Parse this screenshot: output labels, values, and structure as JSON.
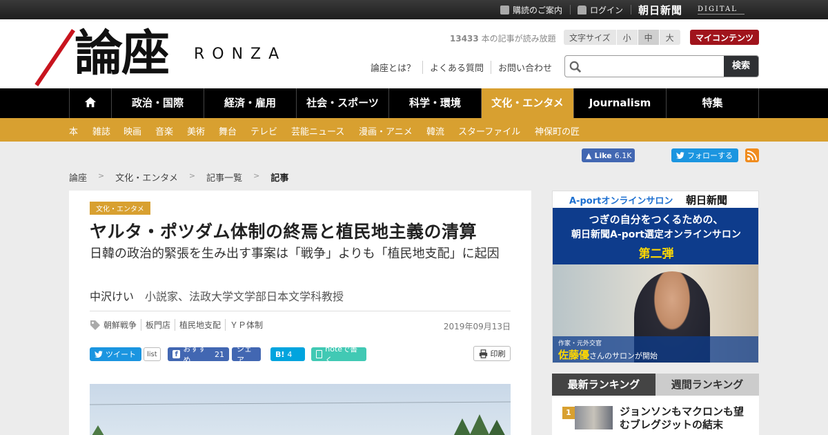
{
  "topbar": {
    "subscribe": "購読のご案内",
    "login": "ログイン",
    "brand": "朝日新聞",
    "brand_suffix": "DIGITAL"
  },
  "header": {
    "logo_kanji": "論座",
    "logo_roman": "RONZA",
    "reading_count": "13433",
    "reading_suffix": "本の記事が読み放題",
    "fontsize_label": "文字サイズ",
    "fontsize_options": [
      "小",
      "中",
      "大"
    ],
    "fontsize_selected": "中",
    "my_contents": "マイコンテンツ",
    "links": [
      "論座とは？",
      "よくある質問",
      "お問い合わせ"
    ],
    "search_placeholder": "",
    "search_button": "検索"
  },
  "nav": {
    "items": [
      "政治・国際",
      "経済・雇用",
      "社会・スポーツ",
      "科学・環境",
      "文化・エンタメ",
      "Journalism",
      "特集"
    ],
    "active": "文化・エンタメ"
  },
  "subnav": {
    "items": [
      "本",
      "雑誌",
      "映画",
      "音楽",
      "美術",
      "舞台",
      "テレビ",
      "芸能ニュース",
      "漫画・アニメ",
      "韓流",
      "スターファイル",
      "神保町の匠"
    ]
  },
  "social": {
    "fb_like": "Like",
    "fb_count": "6.1K",
    "tw_follow": "フォローする"
  },
  "breadcrumb": {
    "items": [
      "論座",
      "文化・エンタメ",
      "記事一覧",
      "記事"
    ],
    "separator": ">"
  },
  "article": {
    "category": "文化・エンタメ",
    "title": "ヤルタ・ポツダム体制の終焉と植民地主義の清算",
    "subtitle": "日韓の政治的緊張を生み出す事案は「戦争」よりも「植民地支配」に起因",
    "author_name": "中沢けい",
    "author_affiliation": "小説家、法政大学文学部日本文学科教授",
    "tags": [
      "朝鮮戦争",
      "板門店",
      "植民地支配",
      "ＹＰ体制"
    ],
    "date": "2019年09月13日",
    "share": {
      "tweet": "ツイート",
      "list": "list",
      "fb_recommend": "おすすめ",
      "fb_count": "21",
      "fb_share": "シェア",
      "hatena": "B!",
      "hatena_count": "4",
      "note": "noteで書く",
      "print": "印刷"
    }
  },
  "ad": {
    "aport": "A-portオンラインサロン",
    "brand": "朝日新聞",
    "line1": "つぎの自分をつくるための、",
    "line2": "朝日新聞A-port選定オンラインサロン",
    "line3": "第二弾",
    "caption_role": "作家・元外交官",
    "caption_name": "佐藤優",
    "caption_rest": "さんのサロンが開始"
  },
  "ranking": {
    "tabs": [
      "最新ランキング",
      "週間ランキング"
    ],
    "active_tab": "最新ランキング",
    "items": [
      {
        "rank": "1",
        "text": "ジョンソンもマクロンも望むブレグジットの結末"
      }
    ]
  },
  "colors": {
    "accent": "#d8a030",
    "nav_bg": "#000000",
    "my_contents": "#a0141c",
    "facebook": "#4267b2",
    "twitter": "#1b95e0"
  }
}
